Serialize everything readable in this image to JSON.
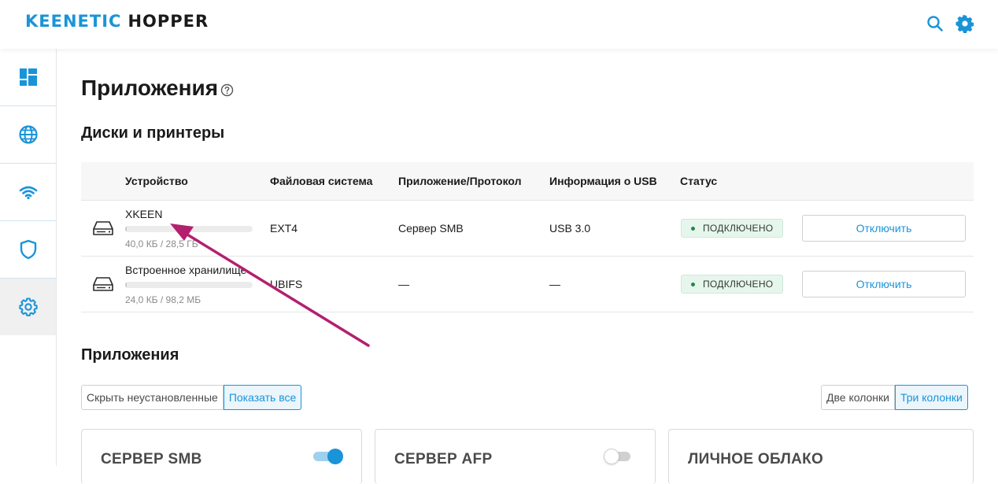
{
  "header": {
    "brand": "KEENETIC",
    "product": "HOPPER"
  },
  "sidebar": {
    "items": [
      {
        "name": "dashboard",
        "icon": "dashboard-icon"
      },
      {
        "name": "internet",
        "icon": "globe-icon"
      },
      {
        "name": "wifi",
        "icon": "wifi-icon"
      },
      {
        "name": "security",
        "icon": "shield-icon"
      },
      {
        "name": "settings",
        "icon": "gear-icon",
        "active": true
      }
    ]
  },
  "page": {
    "title": "Приложения",
    "disks_title": "Диски и принтеры",
    "apps_title": "Приложения"
  },
  "disks_table": {
    "columns": [
      "Устройство",
      "Файловая система",
      "Приложение/Протокол",
      "Информация о USB",
      "Статус"
    ],
    "rows": [
      {
        "name": "XKEEN",
        "usage": "40,0 КБ / 28,5 ГБ",
        "usage_fraction": 0.01,
        "fs": "EXT4",
        "protocol": "Сервер SMB",
        "usb": "USB 3.0",
        "status": "ПОДКЛЮЧЕНО",
        "action": "Отключить"
      },
      {
        "name": "Встроенное хранилище",
        "usage": "24,0 КБ / 98,2 МБ",
        "usage_fraction": 0.01,
        "fs": "UBIFS",
        "protocol": "—",
        "usb": "—",
        "status": "ПОДКЛЮЧЕНО",
        "action": "Отключить"
      }
    ]
  },
  "filters": {
    "hide_uninstalled": "Скрыть неустановленные",
    "show_all": "Показать все",
    "two_columns": "Две колонки",
    "three_columns": "Три колонки"
  },
  "cards": [
    {
      "title": "СЕРВЕР SMB",
      "enabled": true
    },
    {
      "title": "СЕРВЕР AFP",
      "enabled": false
    },
    {
      "title": "ЛИЧНОЕ ОБЛАКО"
    }
  ],
  "colors": {
    "accent": "#1a94d8",
    "status_ok": "#1f8a48",
    "annotation_arrow": "#b3206e"
  }
}
